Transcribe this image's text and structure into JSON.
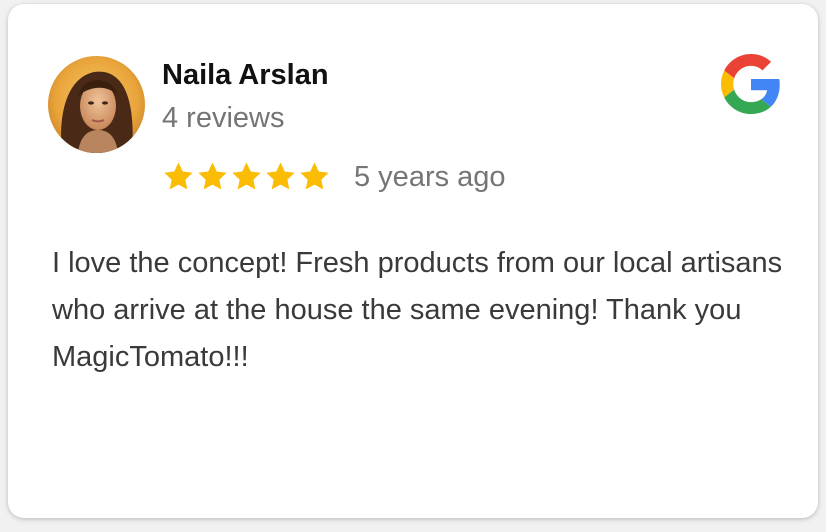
{
  "review": {
    "author_name": "Naila Arslan",
    "review_count": "4 reviews",
    "rating": 5,
    "rating_max": 5,
    "time_ago": "5 years ago",
    "text": "I love the concept! Fresh products from our local artisans who arrive at the house the same evening! Thank you MagicTomato!!!"
  },
  "icons": {
    "avatar": "user-avatar-photo",
    "platform": "google-g-logo",
    "star": "star-icon"
  },
  "colors": {
    "star": "#FBBC04",
    "name": "#111111",
    "meta": "#757575",
    "body_text": "#3a3a3a",
    "google_blue": "#4285F4",
    "google_red": "#EA4335",
    "google_yellow": "#FBBC05",
    "google_green": "#34A853"
  }
}
